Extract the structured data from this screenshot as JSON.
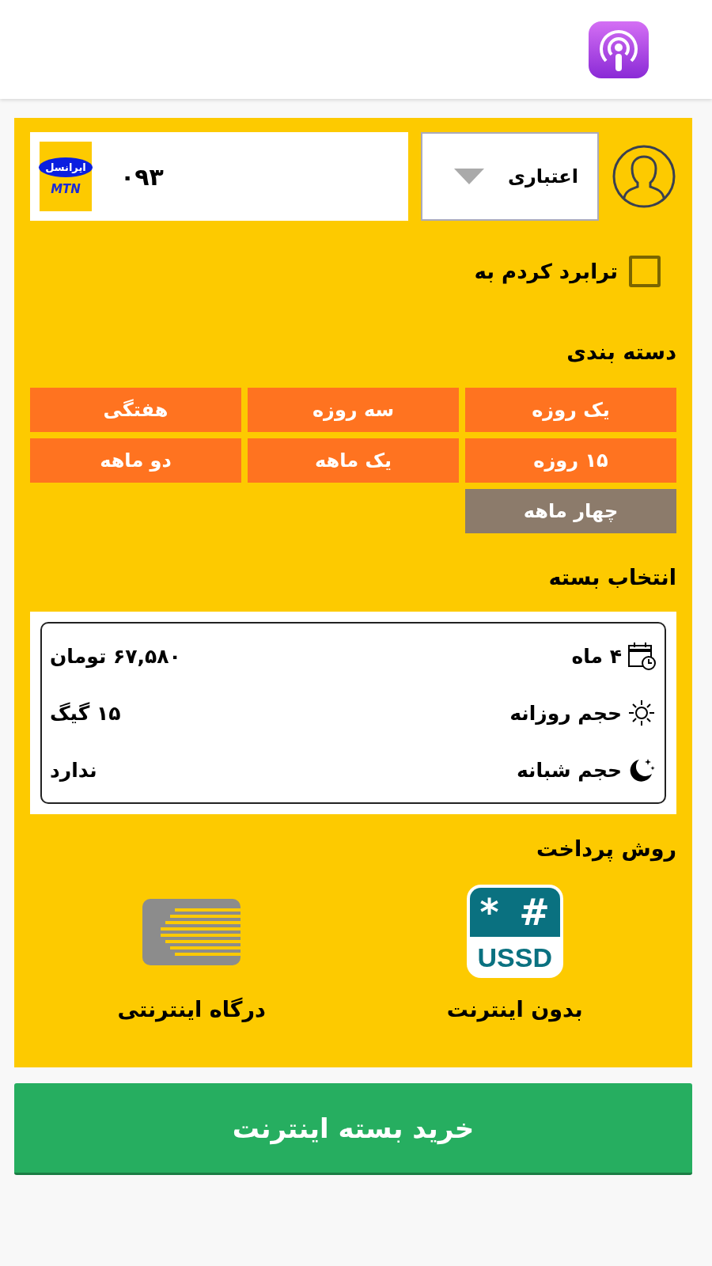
{
  "operator": {
    "logo_top": "ایرانسل",
    "logo_bottom": "MTN",
    "phone": "۰۹۳"
  },
  "sim_type": {
    "value": "اعتباری"
  },
  "transfer": {
    "label": "ترابرد کردم به",
    "checked": false
  },
  "categories_title": "دسته بندی",
  "categories": [
    {
      "label": "یک روزه",
      "selected": false
    },
    {
      "label": "سه روزه",
      "selected": false
    },
    {
      "label": "هفتگی",
      "selected": false
    },
    {
      "label": "۱۵ روزه",
      "selected": false
    },
    {
      "label": "یک ماهه",
      "selected": false
    },
    {
      "label": "دو ماهه",
      "selected": false
    },
    {
      "label": "چهار ماهه",
      "selected": true
    }
  ],
  "package_title": "انتخاب بسته",
  "package": {
    "rows": [
      {
        "kind": "duration",
        "label": "۴ ماه",
        "value": "۶۷,۵۸۰ تومان"
      },
      {
        "kind": "day",
        "label": "حجم روزانه",
        "value": "۱۵ گیگ"
      },
      {
        "kind": "night",
        "label": "حجم شبانه",
        "value": "ندارد"
      }
    ]
  },
  "payment_title": "روش پرداخت",
  "payment_methods": [
    {
      "kind": "ussd",
      "label": "بدون اینترنت",
      "logo_symbols": [
        "#",
        "*"
      ],
      "logo_text": "USSD"
    },
    {
      "kind": "gateway",
      "label": "درگاه اینترنتی"
    }
  ],
  "buy_button": "خرید بسته اینترنت"
}
